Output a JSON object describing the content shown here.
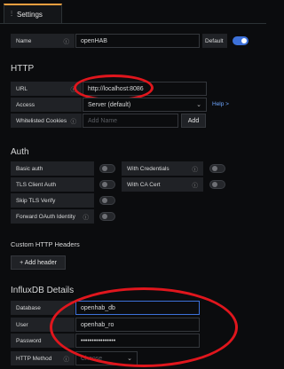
{
  "tab": {
    "icon": "sliders-icon",
    "label": "Settings"
  },
  "name_row": {
    "label": "Name",
    "value": "openHAB",
    "default_label": "Default",
    "default_on": true
  },
  "http": {
    "title": "HTTP",
    "url": {
      "label": "URL",
      "value": "http://localhost:8086"
    },
    "access": {
      "label": "Access",
      "value": "Server (default)",
      "help": "Help >"
    },
    "cookies": {
      "label": "Whitelisted Cookies",
      "placeholder": "Add Name",
      "button": "Add"
    }
  },
  "auth": {
    "title": "Auth",
    "basic": "Basic auth",
    "with_credentials": "With Credentials",
    "tls_client": "TLS Client Auth",
    "with_ca": "With CA Cert",
    "skip_tls": "Skip TLS Verify",
    "forward_oauth": "Forward OAuth Identity"
  },
  "custom_headers": {
    "title": "Custom HTTP Headers",
    "button": "+ Add header"
  },
  "influx": {
    "title": "InfluxDB Details",
    "database": {
      "label": "Database",
      "value": "openhab_db"
    },
    "user": {
      "label": "User",
      "value": "openhab_ro"
    },
    "password": {
      "label": "Password",
      "value": "••••••••••••••••"
    },
    "method": {
      "label": "HTTP Method",
      "placeholder": "Choose"
    }
  },
  "colors": {
    "accent": "#3d71d9",
    "highlight_circle": "#e0161d",
    "tab_top": "#f5a040"
  }
}
